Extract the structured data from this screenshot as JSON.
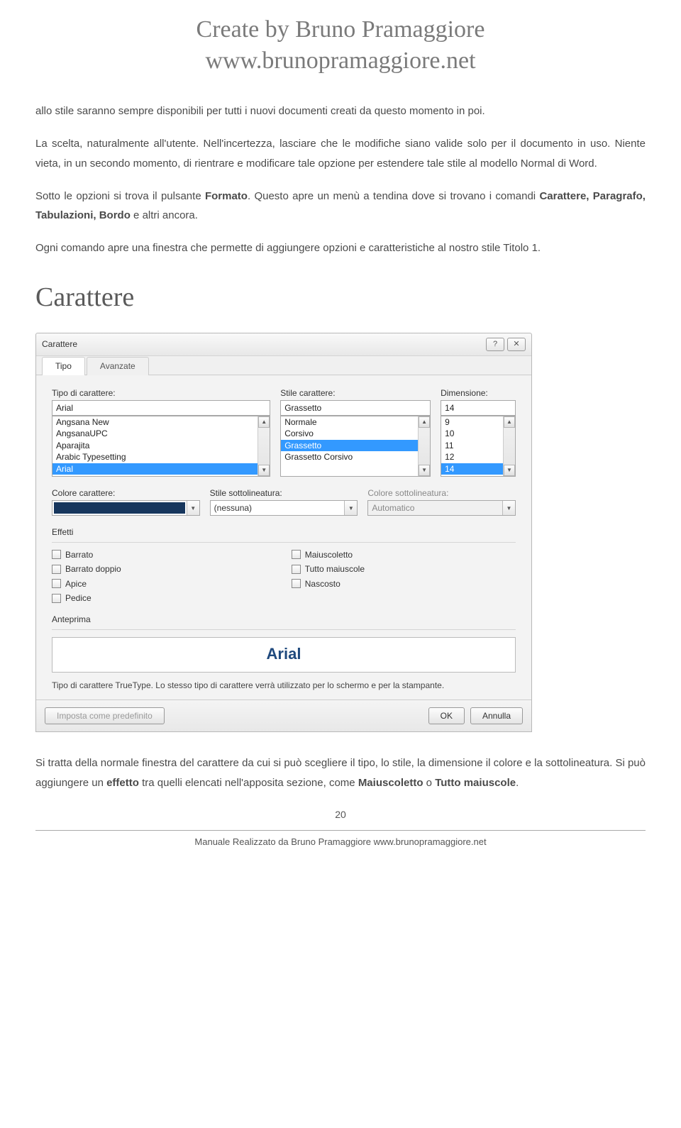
{
  "header": {
    "line1": "Create by Bruno Pramaggiore",
    "line2": "www.brunopramaggiore.net"
  },
  "paragraphs": {
    "p1": "allo stile saranno sempre disponibili per tutti i nuovi documenti creati da questo momento in poi.",
    "p2": "La scelta, naturalmente all'utente. Nell'incertezza, lasciare che le modifiche siano valide solo per il documento in uso. Niente vieta, in un secondo momento, di rientrare e modificare tale opzione per estendere tale stile al modello Normal di Word.",
    "p3a": "Sotto le opzioni si trova il pulsante ",
    "p3b": "Formato",
    "p3c": ". Questo apre un menù a tendina dove si trovano i comandi ",
    "p3d": "Carattere, Paragrafo, Tabulazioni, Bordo",
    "p3e": " e altri ancora.",
    "p4": "Ogni comando apre una finestra che permette di aggiungere opzioni e caratteristiche al nostro stile Titolo 1.",
    "p5a": "Si tratta della normale finestra del carattere da cui si può scegliere il tipo, lo stile, la dimensione il colore e la sottolineatura. Si può aggiungere un ",
    "p5b": "effetto",
    "p5c": " tra quelli elencati nell'apposita sezione, come ",
    "p5d": "Maiuscoletto",
    "p5e": " o ",
    "p5f": "Tutto maiuscole",
    "p5g": "."
  },
  "section_title": "Carattere",
  "dialog": {
    "title": "Carattere",
    "tabs": {
      "tipo": "Tipo",
      "avanzate": "Avanzate"
    },
    "labels": {
      "font": "Tipo di carattere:",
      "style": "Stile carattere:",
      "size": "Dimensione:",
      "color": "Colore carattere:",
      "underline": "Stile sottolineatura:",
      "ulcolor": "Colore sottolineatura:",
      "effects": "Effetti",
      "preview": "Anteprima"
    },
    "font": {
      "value": "Arial",
      "list": [
        "Angsana New",
        "AngsanaUPC",
        "Aparajita",
        "Arabic Typesetting",
        "Arial"
      ],
      "selected": "Arial"
    },
    "style": {
      "value": "Grassetto",
      "list": [
        "Normale",
        "Corsivo",
        "Grassetto",
        "Grassetto Corsivo"
      ],
      "selected": "Grassetto"
    },
    "size": {
      "value": "14",
      "list": [
        "9",
        "10",
        "11",
        "12",
        "14"
      ],
      "selected": "14"
    },
    "underline_style": "(nessuna)",
    "underline_color": "Automatico",
    "effects": {
      "left": [
        "Barrato",
        "Barrato doppio",
        "Apice",
        "Pedice"
      ],
      "right": [
        "Maiuscoletto",
        "Tutto maiuscole",
        "Nascosto"
      ]
    },
    "preview_text": "Arial",
    "note": "Tipo di carattere TrueType. Lo stesso tipo di carattere verrà utilizzato per lo schermo e per la stampante.",
    "buttons": {
      "default": "Imposta come predefinito",
      "ok": "OK",
      "cancel": "Annulla"
    }
  },
  "page_number": "20",
  "doc_footer": "Manuale Realizzato da Bruno Pramaggiore  www.brunopramaggiore.net"
}
